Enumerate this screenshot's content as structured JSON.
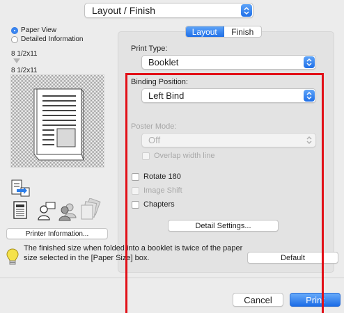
{
  "top_popup": {
    "value": "Layout / Finish"
  },
  "left": {
    "view_options": [
      {
        "label": "Paper View",
        "selected": true
      },
      {
        "label": "Detailed Information",
        "selected": false
      }
    ],
    "original_size": "8 1/2x11",
    "output_size": "8 1/2x11",
    "printer_info_button": "Printer Information..."
  },
  "tabs": [
    {
      "label": "Layout",
      "active": true
    },
    {
      "label": "Finish",
      "active": false
    }
  ],
  "print_type": {
    "label": "Print Type:",
    "value": "Booklet"
  },
  "binding_position": {
    "label": "Binding Position:",
    "value": "Left Bind"
  },
  "poster_mode": {
    "label": "Poster Mode:",
    "value": "Off",
    "overlap_label": "Overlap width line"
  },
  "checkboxes": [
    {
      "label": "Rotate 180",
      "enabled": true,
      "checked": false
    },
    {
      "label": "Image Shift",
      "enabled": false,
      "checked": false
    },
    {
      "label": "Chapters",
      "enabled": true,
      "checked": false
    }
  ],
  "detail_settings_button": "Detail Settings...",
  "info_message": "The finished size when folded into a booklet is twice of the paper size selected in the [Paper Size] box.",
  "default_button": "Default",
  "cancel_button": "Cancel",
  "print_button": "Print",
  "colors": {
    "accent": "#1f6fe8",
    "highlight": "#e20f17"
  }
}
